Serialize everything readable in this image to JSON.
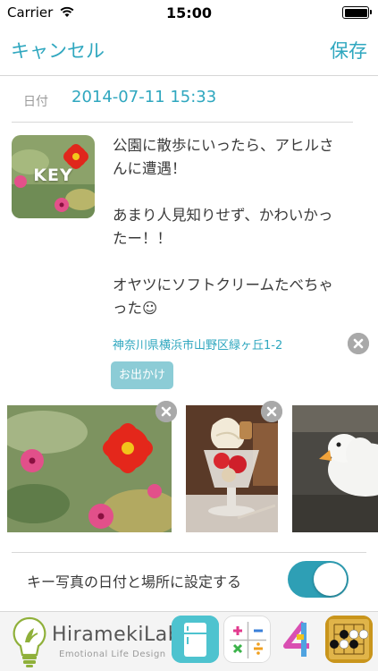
{
  "status_bar": {
    "carrier": "Carrier",
    "time": "15:00"
  },
  "nav": {
    "cancel_label": "キャンセル",
    "save_label": "保存"
  },
  "date": {
    "label": "日付",
    "value": "2014-07-11 15:33"
  },
  "key_photo": {
    "label": "KEY"
  },
  "note": {
    "lines": [
      "公園に散歩にいったら、アヒルさ",
      "んに遭遇！",
      "",
      "あまり人見知りせず、かわいかっ",
      "たー！！",
      "",
      "オヤツにソフトクリームたべちゃ",
      "った☺"
    ]
  },
  "location": {
    "text": "神奈川県横浜市山野区緑ヶ丘1-2"
  },
  "tag": {
    "label": "お出かけ"
  },
  "photos": [
    {
      "name": "flower-photo"
    },
    {
      "name": "parfait-photo"
    },
    {
      "name": "duck-photo"
    }
  ],
  "setting": {
    "label": "キー写真の日付と場所に設定する",
    "enabled": true
  },
  "banner": {
    "brand": "HiramekiLab",
    "tagline": "Emotional Life Design"
  },
  "colors": {
    "accent": "#2fa7bf",
    "tag_bg": "#8cccd6",
    "toggle_on": "#2e9fb5"
  }
}
